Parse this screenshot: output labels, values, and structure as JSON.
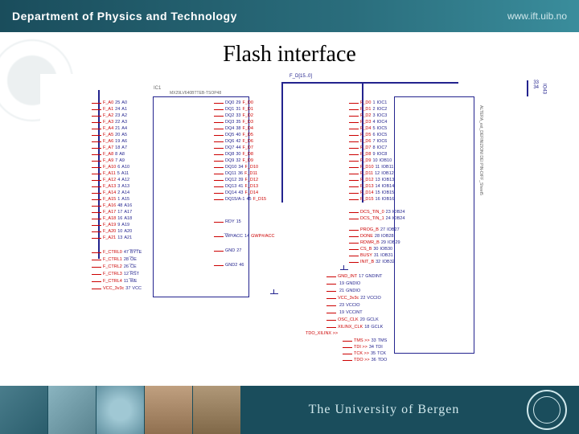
{
  "header": {
    "dept": "Department of Physics and Technology",
    "url": "www.ift.uib.no"
  },
  "title": "Flash interface",
  "footer": {
    "university": "The University of Bergen"
  },
  "chip1": {
    "ref": "IC1",
    "part": "MX29LV640BTTEB-TSOP48",
    "left_pins": [
      {
        "net": "F_A0",
        "num": "25",
        "name": "A0"
      },
      {
        "net": "F_A1",
        "num": "24",
        "name": "A1"
      },
      {
        "net": "F_A2",
        "num": "23",
        "name": "A2"
      },
      {
        "net": "F_A3",
        "num": "22",
        "name": "A3"
      },
      {
        "net": "F_A4",
        "num": "21",
        "name": "A4"
      },
      {
        "net": "F_A5",
        "num": "20",
        "name": "A5"
      },
      {
        "net": "F_A6",
        "num": "19",
        "name": "A6"
      },
      {
        "net": "F_A7",
        "num": "18",
        "name": "A7"
      },
      {
        "net": "F_A8",
        "num": "8",
        "name": "A8"
      },
      {
        "net": "F_A9",
        "num": "7",
        "name": "A9"
      },
      {
        "net": "F_A10",
        "num": "6",
        "name": "A10"
      },
      {
        "net": "F_A11",
        "num": "5",
        "name": "A11"
      },
      {
        "net": "F_A12",
        "num": "4",
        "name": "A12"
      },
      {
        "net": "F_A13",
        "num": "3",
        "name": "A13"
      },
      {
        "net": "F_A14",
        "num": "2",
        "name": "A14"
      },
      {
        "net": "F_A15",
        "num": "1",
        "name": "A15"
      },
      {
        "net": "F_A16",
        "num": "48",
        "name": "A16"
      },
      {
        "net": "F_A17",
        "num": "17",
        "name": "A17"
      },
      {
        "net": "F_A18",
        "num": "16",
        "name": "A18"
      },
      {
        "net": "F_A19",
        "num": "9",
        "name": "A19"
      },
      {
        "net": "F_A20",
        "num": "10",
        "name": "A20"
      },
      {
        "net": "F_A21",
        "num": "13",
        "name": "A21"
      }
    ],
    "right_pins": [
      {
        "name": "DQ0",
        "num": "29",
        "net": "F_D0"
      },
      {
        "name": "DQ1",
        "num": "31",
        "net": "F_D1"
      },
      {
        "name": "DQ2",
        "num": "33",
        "net": "F_D2"
      },
      {
        "name": "DQ3",
        "num": "35",
        "net": "F_D3"
      },
      {
        "name": "DQ4",
        "num": "38",
        "net": "F_D4"
      },
      {
        "name": "DQ5",
        "num": "40",
        "net": "F_D5"
      },
      {
        "name": "DQ6",
        "num": "42",
        "net": "F_D6"
      },
      {
        "name": "DQ7",
        "num": "44",
        "net": "F_D7"
      },
      {
        "name": "DQ8",
        "num": "30",
        "net": "F_D8"
      },
      {
        "name": "DQ9",
        "num": "32",
        "net": "F_D9"
      },
      {
        "name": "DQ10",
        "num": "34",
        "net": "F_D10"
      },
      {
        "name": "DQ11",
        "num": "36",
        "net": "F_D11"
      },
      {
        "name": "DQ12",
        "num": "39",
        "net": "F_D12"
      },
      {
        "name": "DQ13",
        "num": "41",
        "net": "F_D13"
      },
      {
        "name": "DQ14",
        "num": "43",
        "net": "F_D14"
      },
      {
        "name": "DQ15/A-1",
        "num": "45",
        "net": "F_D15"
      }
    ],
    "ctrl_left": [
      {
        "net": "F_CTRL0",
        "num": "47",
        "name": "̅B̅Y̅T̅E"
      },
      {
        "net": "F_CTRL1",
        "num": "28",
        "name": "̅O̅E"
      },
      {
        "net": "F_CTRL2",
        "num": "26",
        "name": "̅C̅E"
      },
      {
        "net": "F_CTRL3",
        "num": "12",
        "name": "̅R̅S̅T"
      },
      {
        "net": "F_CTRL4",
        "num": "11",
        "name": "̅W̅E"
      },
      {
        "net": "VCC_3v3c",
        "num": "37",
        "name": "VCC"
      }
    ],
    "ctrl_right": [
      {
        "name": "RDY",
        "num": "15",
        "net": ""
      },
      {
        "name": "̅W̅P/ACC",
        "num": "14",
        "net": "GWP#/ACC"
      },
      {
        "name": "GND",
        "num": "27",
        "net": ""
      },
      {
        "name": "GND2",
        "num": "46",
        "net": ""
      }
    ]
  },
  "chip2": {
    "label": "ALTERA_ext_DEFINIZIONI DEI PIN-DIFF_Sheet5",
    "left_pins": [
      {
        "net": "F_D0",
        "num": "1",
        "name": "IOC1"
      },
      {
        "net": "F_D1",
        "num": "2",
        "name": "IOC2"
      },
      {
        "net": "F_D2",
        "num": "3",
        "name": "IOC3"
      },
      {
        "net": "F_D3",
        "num": "4",
        "name": "IOC4"
      },
      {
        "net": "F_D4",
        "num": "5",
        "name": "IOC5"
      },
      {
        "net": "F_D5",
        "num": "6",
        "name": "IOC5"
      },
      {
        "net": "F_D6",
        "num": "7",
        "name": "IOC6"
      },
      {
        "net": "F_D7",
        "num": "8",
        "name": "IOC7"
      },
      {
        "net": "F_D8",
        "num": "9",
        "name": "IOC8"
      },
      {
        "net": "F_D9",
        "num": "10",
        "name": "IOB10"
      },
      {
        "net": "F_D10",
        "num": "11",
        "name": "IOB11"
      },
      {
        "net": "F_D11",
        "num": "12",
        "name": "IOB12"
      },
      {
        "net": "F_D12",
        "num": "13",
        "name": "IOB13"
      },
      {
        "net": "F_D13",
        "num": "14",
        "name": "IOB14"
      },
      {
        "net": "F_D14",
        "num": "15",
        "name": "IOB15"
      },
      {
        "net": "F_D15",
        "num": "16",
        "name": "IOB16"
      },
      {
        "net": "DCS_TIN_0",
        "num": "23",
        "name": "IOB24"
      },
      {
        "net": "DCS_TIN_1",
        "num": "24",
        "name": "IOB24"
      },
      {
        "net": "PROG_B",
        "num": "27",
        "name": "IOB27"
      },
      {
        "net": "DONE",
        "num": "28",
        "name": "IOB28"
      },
      {
        "net": "RDWR_B",
        "num": "29",
        "name": "IOB29"
      },
      {
        "net": "CS_B",
        "num": "30",
        "name": "IOB30"
      },
      {
        "net": "BUSY",
        "num": "31",
        "name": "IOB31"
      },
      {
        "net": "INIT_B",
        "num": "32",
        "name": "IOB32"
      }
    ],
    "mid_pins": [
      {
        "net": "GND_INT",
        "num": "17",
        "name": "GNDINT"
      },
      {
        "net": "",
        "num": "19",
        "name": "GNDIO"
      },
      {
        "net": "",
        "num": "21",
        "name": "GNDIO"
      },
      {
        "net": "VCC_3v3c",
        "num": "22",
        "name": "VCCIO"
      },
      {
        "net": "",
        "num": "23",
        "name": "VCCIO"
      },
      {
        "net": "",
        "num": "19",
        "name": "VCCINT"
      },
      {
        "net": "OSC_CLK",
        "num": "20",
        "name": "GCLK"
      },
      {
        "net": "XILINX_CLK",
        "num": "18",
        "name": "GCLK"
      }
    ],
    "jtag_pins": [
      {
        "net": "TMS",
        "num": "33",
        "name": "TMS"
      },
      {
        "net": "TDI",
        "num": "34",
        "name": "TDI"
      },
      {
        "net": "TCK",
        "num": "35",
        "name": "TCK"
      },
      {
        "net": "TDO",
        "num": "36",
        "name": "TDO"
      }
    ],
    "tdo_net": "TDO_XILINX"
  },
  "buses": {
    "data": "F_D[15..0]"
  },
  "power": {
    "label": "IO43",
    "pins": [
      "33",
      "34"
    ]
  }
}
